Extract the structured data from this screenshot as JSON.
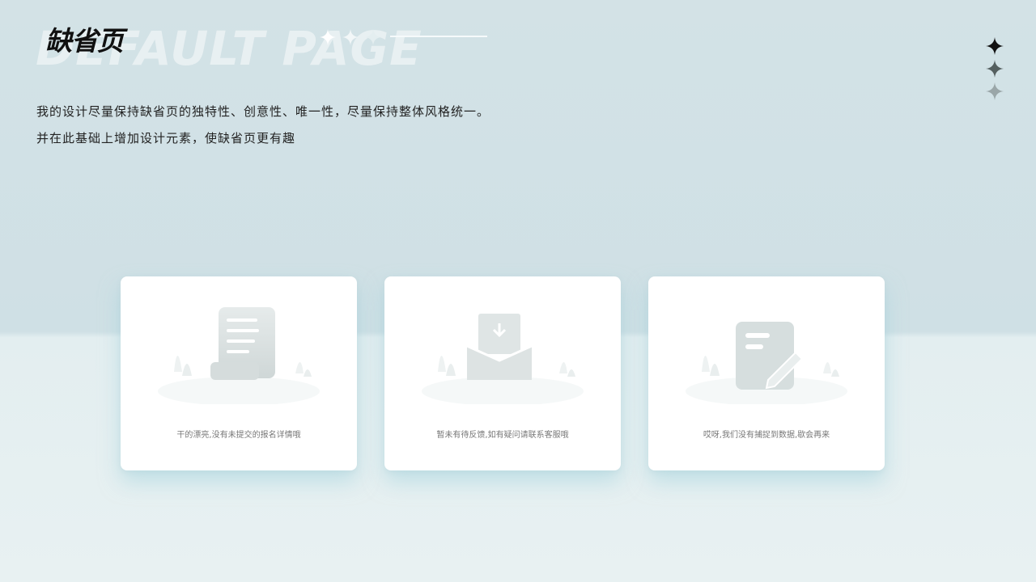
{
  "header": {
    "title": "缺省页",
    "background_word": "DEFAULT PAGE"
  },
  "description": {
    "line1": "我的设计尽量保持缺省页的独特性、创意性、唯一性，尽量保持整体风格统一。",
    "line2": "并在此基础上增加设计元素，使缺省页更有趣"
  },
  "cards": [
    {
      "icon": "scroll-document-icon",
      "caption": "干的漂亮,没有未提交的报名详情哦"
    },
    {
      "icon": "mail-download-icon",
      "caption": "暂未有待反馈,如有疑问请联系客服哦"
    },
    {
      "icon": "note-edit-icon",
      "caption": "哎呀,我们没有捕捉到数据,歇会再来"
    }
  ],
  "colors": {
    "background_top": "#d3e2e6",
    "background_bottom": "#e8f1f2",
    "card": "#ffffff",
    "icon_gray": "#dde3e3",
    "title": "#111111"
  }
}
